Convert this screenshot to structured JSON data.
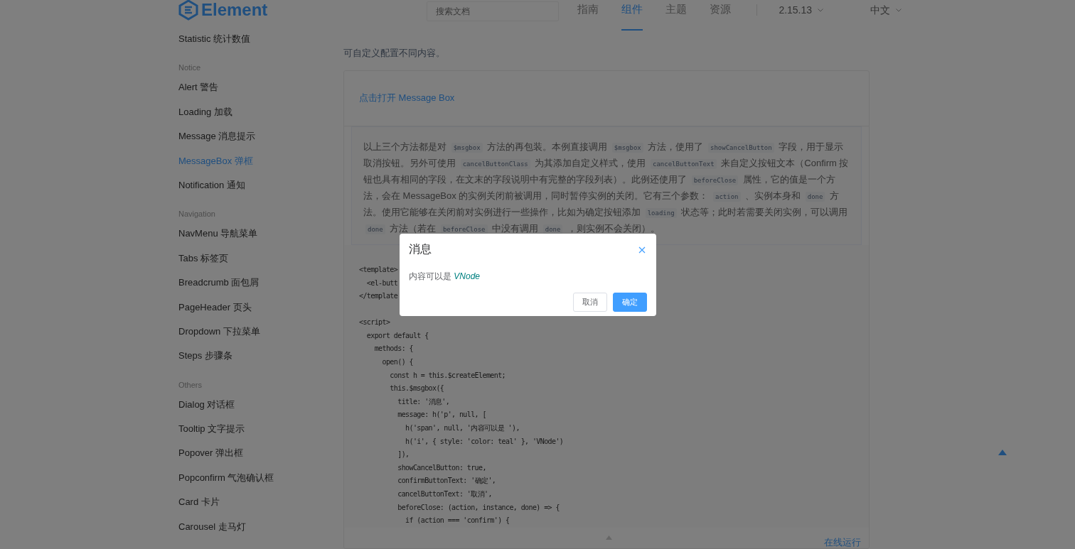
{
  "header": {
    "logo": "Element",
    "search": {
      "placeholder": "搜索文档"
    },
    "nav": [
      {
        "label": "指南",
        "selected": false
      },
      {
        "label": "组件",
        "selected": true
      },
      {
        "label": "主题",
        "selected": false
      },
      {
        "label": "资源",
        "selected": false
      }
    ],
    "version": "2.15.13",
    "language": "中文"
  },
  "sidebar": {
    "items": [
      {
        "kind": "item",
        "label": "Statistic 统计数值",
        "selected": false
      },
      {
        "kind": "group",
        "label": "Notice"
      },
      {
        "kind": "item",
        "label": "Alert 警告",
        "selected": false
      },
      {
        "kind": "item",
        "label": "Loading 加载",
        "selected": false
      },
      {
        "kind": "item",
        "label": "Message 消息提示",
        "selected": false
      },
      {
        "kind": "item",
        "label": "MessageBox 弹框",
        "selected": true
      },
      {
        "kind": "item",
        "label": "Notification 通知",
        "selected": false
      },
      {
        "kind": "group",
        "label": "Navigation"
      },
      {
        "kind": "item",
        "label": "NavMenu 导航菜单",
        "selected": false
      },
      {
        "kind": "item",
        "label": "Tabs 标签页",
        "selected": false
      },
      {
        "kind": "item",
        "label": "Breadcrumb 面包屑",
        "selected": false
      },
      {
        "kind": "item",
        "label": "PageHeader 页头",
        "selected": false
      },
      {
        "kind": "item",
        "label": "Dropdown 下拉菜单",
        "selected": false
      },
      {
        "kind": "item",
        "label": "Steps 步骤条",
        "selected": false
      },
      {
        "kind": "group",
        "label": "Others"
      },
      {
        "kind": "item",
        "label": "Dialog 对话框",
        "selected": false
      },
      {
        "kind": "item",
        "label": "Tooltip 文字提示",
        "selected": false
      },
      {
        "kind": "item",
        "label": "Popover 弹出框",
        "selected": false
      },
      {
        "kind": "item",
        "label": "Popconfirm 气泡确认框",
        "selected": false
      },
      {
        "kind": "item",
        "label": "Card 卡片",
        "selected": false
      },
      {
        "kind": "item",
        "label": "Carousel 走马灯",
        "selected": false
      }
    ]
  },
  "main": {
    "description": "可自定义配置不同内容。",
    "demo_link": "点击打开 Message Box",
    "paragraph": [
      {
        "kind": "text",
        "text": "以上三个方法都是对 "
      },
      {
        "kind": "code",
        "text": "$msgbox"
      },
      {
        "kind": "text",
        "text": " 方法的再包装。本例直接调用 "
      },
      {
        "kind": "code",
        "text": "$msgbox"
      },
      {
        "kind": "text",
        "text": " 方法，使用了 "
      },
      {
        "kind": "code",
        "text": "showCancelButton"
      },
      {
        "kind": "text",
        "text": " 字段，用于显示取消按钮。另外可使用 "
      },
      {
        "kind": "code",
        "text": "cancelButtonClass"
      },
      {
        "kind": "text",
        "text": " 为其添加自定义样式，使用 "
      },
      {
        "kind": "code",
        "text": "cancelButtonText"
      },
      {
        "kind": "text",
        "text": " 来自定义按钮文本（Confirm 按钮也具有相同的字段，在文末的字段说明中有完整的字段列表）。此例还使用了 "
      },
      {
        "kind": "code",
        "text": "beforeClose"
      },
      {
        "kind": "text",
        "text": " 属性，它的值是一个方法，会在 MessageBox 的实例关闭前被调用，同时暂停实例的关闭。它有三个参数： "
      },
      {
        "kind": "code",
        "text": "action"
      },
      {
        "kind": "text",
        "text": " 、实例本身和 "
      },
      {
        "kind": "code",
        "text": "done"
      },
      {
        "kind": "text",
        "text": " 方法。使用它能够在关闭前对实例进行一些操作，比如为确定按钮添加 "
      },
      {
        "kind": "code",
        "text": "loading"
      },
      {
        "kind": "text",
        "text": " 状态等；此时若需要关闭实例，可以调用 "
      },
      {
        "kind": "code",
        "text": "done"
      },
      {
        "kind": "text",
        "text": " 方法（若在 "
      },
      {
        "kind": "code",
        "text": "beforeClose"
      },
      {
        "kind": "text",
        "text": " 中没有调用 "
      },
      {
        "kind": "code",
        "text": "done"
      },
      {
        "kind": "text",
        "text": " ，则实例不会关闭）。"
      }
    ],
    "code_blocks": [
      [
        "<template>",
        "  <el-butt",
        "</template"
      ],
      [
        "<script>",
        "  export default {",
        "    methods: {",
        "      open() {",
        "        const h = this.$createElement;",
        "        this.$msgbox({",
        "          title: '消息',",
        "          message: h('p', null, [",
        "            h('span', null, '内容可以是 '),",
        "            h('i', { style: 'color: teal' }, 'VNode')",
        "          ]),",
        "          showCancelButton: true,",
        "          confirmButtonText: '确定',",
        "          cancelButtonText: '取消',",
        "          beforeClose: (action, instance, done) => {",
        "            if (action === 'confirm') {"
      ]
    ],
    "run_online": "在线运行"
  },
  "dialog": {
    "title": "消息",
    "message": "内容可以是 *VNode*",
    "buttons": [
      {
        "label": "取消",
        "kind": "default"
      },
      {
        "label": "确定",
        "kind": "primary"
      }
    ]
  }
}
